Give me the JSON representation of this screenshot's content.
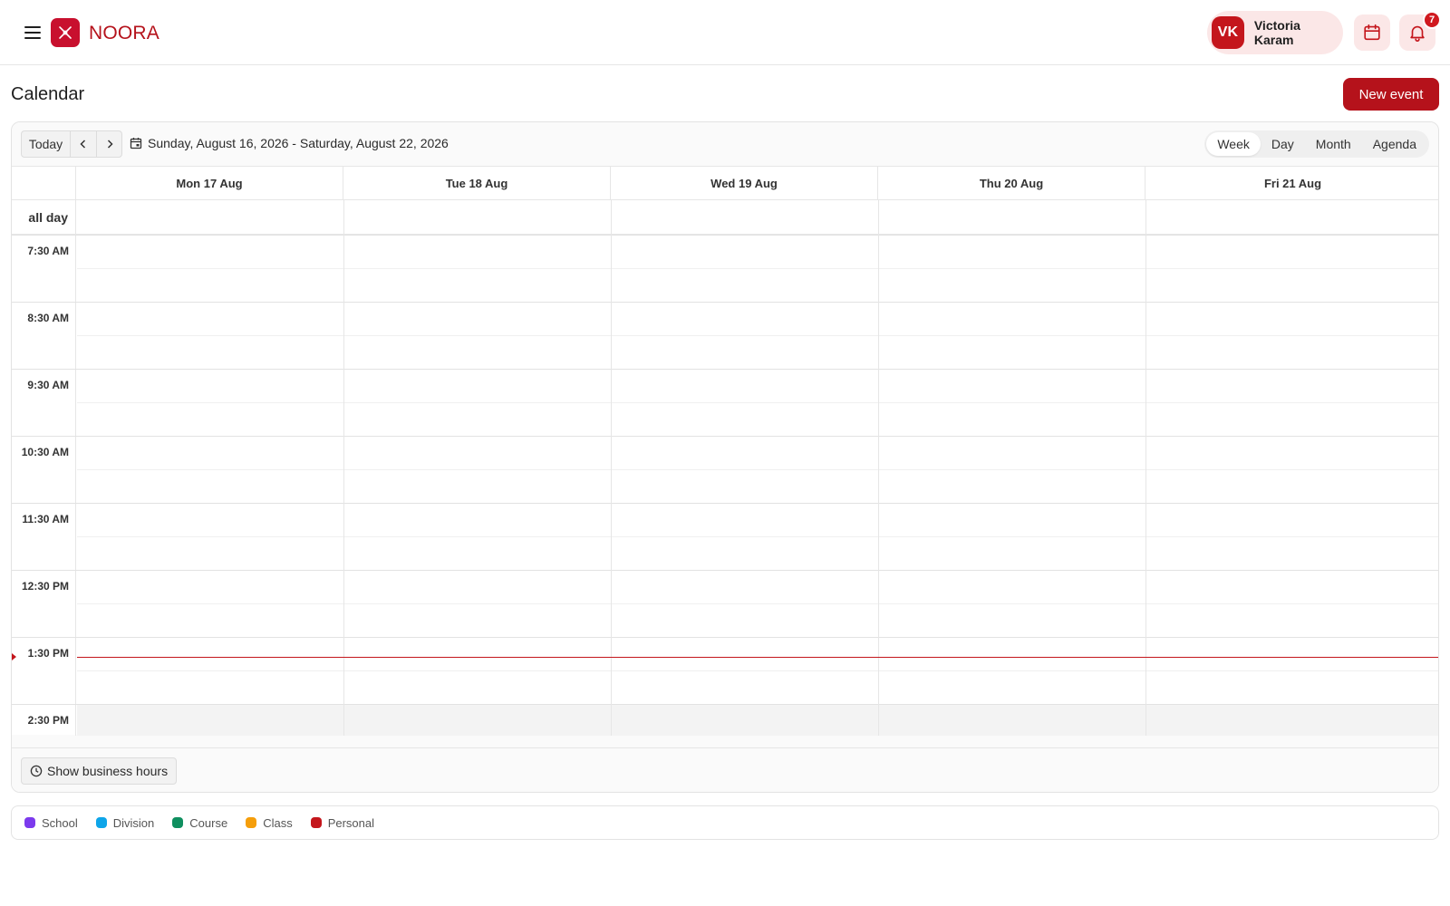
{
  "header": {
    "brand": "NOORA",
    "user": {
      "initials": "VK",
      "name": "Victoria Karam"
    },
    "notifications_count": "7"
  },
  "page": {
    "title": "Calendar",
    "new_event_label": "New event"
  },
  "toolbar": {
    "today_label": "Today",
    "date_range": "Sunday, August 16, 2026 - Saturday, August 22, 2026",
    "views": [
      "Week",
      "Day",
      "Month",
      "Agenda"
    ],
    "active_view": "Week"
  },
  "grid": {
    "days": [
      "Mon 17 Aug",
      "Tue 18 Aug",
      "Wed 19 Aug",
      "Thu 20 Aug",
      "Fri 21 Aug"
    ],
    "all_day_label": "all day",
    "time_labels": [
      "7:30 AM",
      "8:30 AM",
      "9:30 AM",
      "10:30 AM",
      "11:30 AM",
      "12:30 PM",
      "1:30 PM",
      "2:30 PM"
    ]
  },
  "footer": {
    "business_hours_label": "Show business hours"
  },
  "legend": [
    {
      "label": "School",
      "color": "#7c3aed"
    },
    {
      "label": "Division",
      "color": "#0ea5e9"
    },
    {
      "label": "Course",
      "color": "#0f8f5f"
    },
    {
      "label": "Class",
      "color": "#f59e0b"
    },
    {
      "label": "Personal",
      "color": "#c4161c"
    }
  ],
  "colors": {
    "accent": "#b5121b",
    "now_indicator": "#c4161c"
  }
}
